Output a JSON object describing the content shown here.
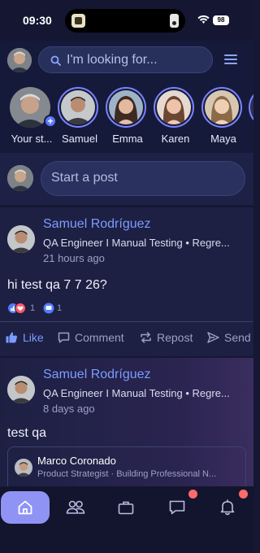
{
  "status_bar": {
    "time": "09:30",
    "battery": "98"
  },
  "search": {
    "placeholder": "I'm looking for..."
  },
  "stories": [
    {
      "label": "Your st..."
    },
    {
      "label": "Samuel"
    },
    {
      "label": "Emma"
    },
    {
      "label": "Karen"
    },
    {
      "label": "Maya"
    }
  ],
  "composer": {
    "placeholder": "Start a post"
  },
  "posts": [
    {
      "author": "Samuel Rodríguez",
      "headline": "QA Engineer I Manual Testing • Regre...",
      "time": "21 hours ago",
      "text": "hi test qa 7 7 26?",
      "reaction_count": "1",
      "comment_count": "1"
    },
    {
      "author": "Samuel Rodríguez",
      "headline": "QA Engineer I Manual Testing • Regre...",
      "time": "8 days ago",
      "text": "test qa",
      "shared": {
        "name": "Marco Coronado",
        "headline": "Product Strategist · Building Professional N..."
      }
    }
  ],
  "actions": {
    "like": "Like",
    "comment": "Comment",
    "repost": "Repost",
    "send": "Send"
  },
  "colors": {
    "accent": "#7a9cff",
    "nav_active": "#8f93f4",
    "notification": "#ff6b6b"
  }
}
